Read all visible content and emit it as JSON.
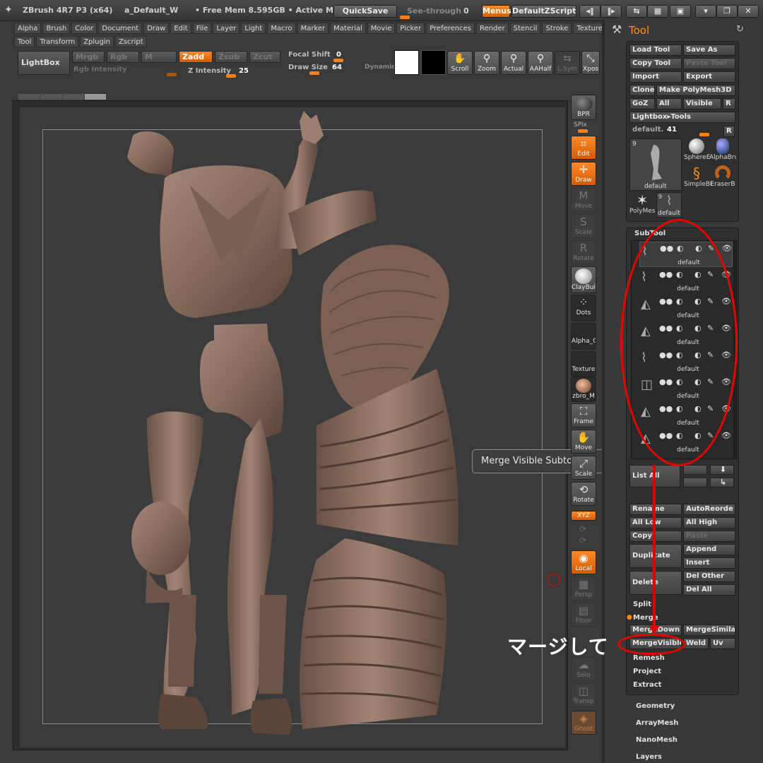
{
  "titlebar": {
    "app": "ZBrush 4R7 P3 (x64)",
    "doc": "a_Default_W",
    "mem": "• Free Mem 8.595GB • Active M",
    "quicksave": "QuickSave",
    "seethrough_label": "See-through",
    "seethrough_value": "0",
    "menus": "Menus",
    "zscript": "DefaultZScript"
  },
  "menubar": {
    "row1": [
      "Alpha",
      "Brush",
      "Color",
      "Document",
      "Draw",
      "Edit",
      "File",
      "Layer",
      "Light",
      "Macro",
      "Marker",
      "Material",
      "Movie",
      "Picker",
      "Preferences",
      "Render",
      "Stencil",
      "Stroke",
      "Texture"
    ],
    "row2": [
      "Tool",
      "Transform",
      "Zplugin",
      "Zscript"
    ]
  },
  "shelf": {
    "lightbox": "LightBox",
    "mrgb": "Mrgb",
    "rgb": "Rgb",
    "m": "M",
    "zadd": "Zadd",
    "zsub": "Zsub",
    "zcut": "Zcut",
    "rgb_intensity": "Rgb Intensity",
    "z_intensity_label": "Z Intensity",
    "z_intensity_value": "25",
    "focal_shift_label": "Focal Shift",
    "focal_shift_value": "0",
    "draw_size_label": "Draw Size",
    "draw_size_value": "64",
    "dynamic": "Dynamic",
    "scroll": "Scroll",
    "zoom": "Zoom",
    "actual": "Actual",
    "aahalf": "AAHalf",
    "lsym": "L.Sym",
    "xpose": "Xpos"
  },
  "right_tray": {
    "bpr": "BPR",
    "spix": "SPix",
    "edit": "Edit",
    "draw": "Draw",
    "move": "Move",
    "scale": "Scale",
    "rotate": "Rotate",
    "claybuild": "ClayBuil",
    "dots": "Dots",
    "alpha": "Alpha_C",
    "texture": "Texture",
    "material": "zbro_M",
    "frame": "Frame",
    "move2": "Move",
    "scale2": "Scale",
    "rotate2": "Rotate",
    "xyz": "XYZ",
    "local": "Local",
    "persp": "Persp",
    "floor": "Floor",
    "solo": "Solo",
    "transp": "Transp",
    "ghost": "Ghost"
  },
  "tooltip": "Merge Visible Subtools",
  "annotation": "マージして",
  "tool": {
    "title": "Tool",
    "load_tool": "Load Tool",
    "save_as": "Save As",
    "copy_tool": "Copy Tool",
    "paste_tool": "Paste Tool",
    "import": "Import",
    "export": "Export",
    "clone": "Clone",
    "make_polymesh": "Make PolyMesh3D",
    "goz": "GoZ",
    "all": "All",
    "visible": "Visible",
    "r": "R",
    "lightbox_tools": "Lightbox▸Tools",
    "default_label": "default.",
    "default_value": "41",
    "thumb_count": "9",
    "thumb_name": "default",
    "thumbs": [
      "SphereE",
      "AlphaBru",
      "SimpleBi",
      "EraserB",
      "PolyMes",
      "default"
    ],
    "subtool_header": "SubTool",
    "subtool_rows": [
      "default",
      "default",
      "default",
      "default",
      "default",
      "default",
      "default",
      "default"
    ],
    "list_all": "List All",
    "rename": "Rename",
    "auto_reorder": "AutoReorde",
    "all_low": "All Low",
    "all_high": "All High",
    "copy": "Copy",
    "paste": "Paste",
    "duplicate": "Duplicate",
    "append": "Append",
    "insert": "Insert",
    "delete": "Delete",
    "del_other": "Del Other",
    "del_all": "Del All",
    "split": "Split",
    "merge": "Merge",
    "merge_down": "MergeDown",
    "merge_similar": "MergeSimilar",
    "merge_visible": "MergeVisible",
    "weld": "Weld",
    "uv": "Uv",
    "remesh": "Remesh",
    "project": "Project",
    "extract": "Extract",
    "geometry": "Geometry",
    "arraymesh": "ArrayMesh",
    "nanomesh": "NanoMesh",
    "layers": "Layers"
  },
  "colors": {
    "accent": "#ff7f1a",
    "annotation_red": "#e00000",
    "clay": "#8a6f62"
  }
}
